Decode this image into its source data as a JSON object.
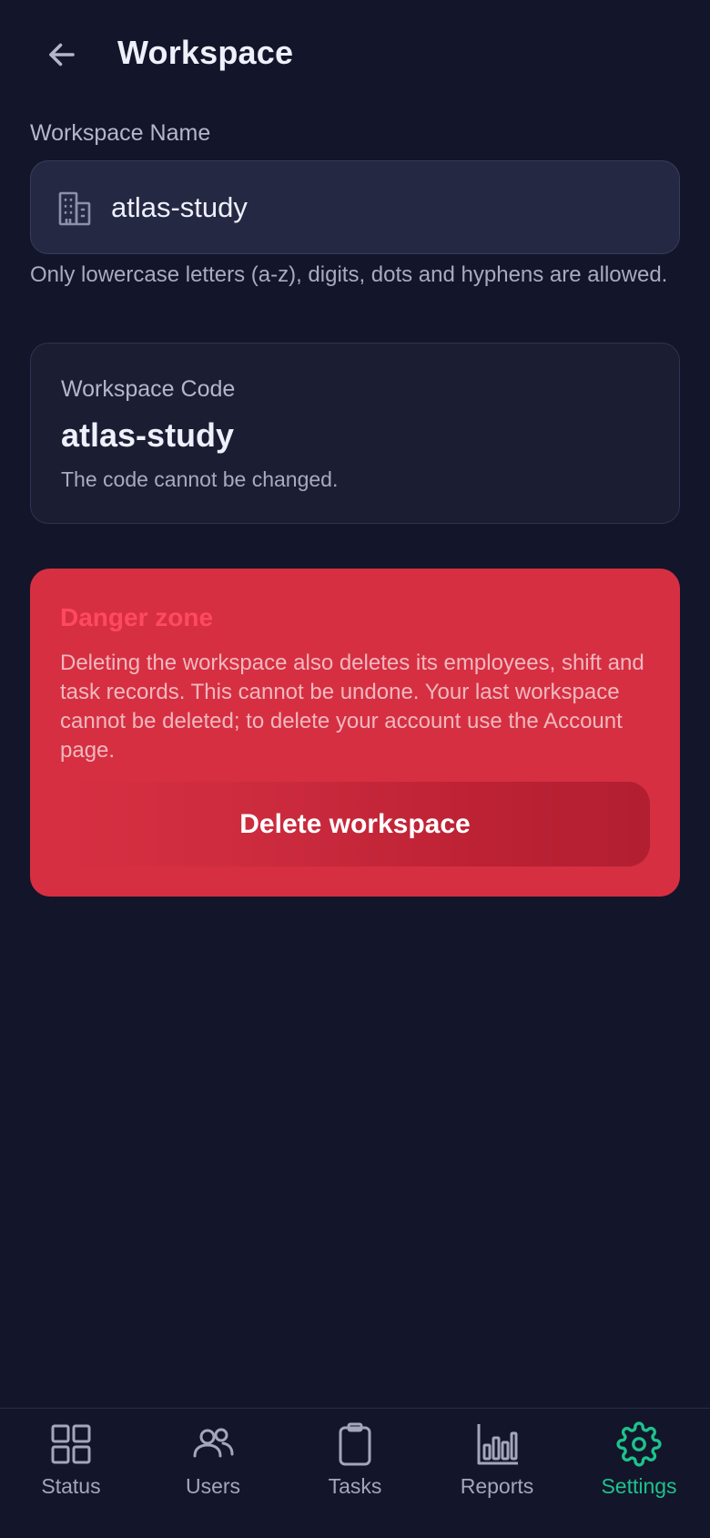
{
  "header": {
    "title": "Workspace",
    "back_icon": "arrow-left-icon"
  },
  "workspace_name": {
    "label": "Workspace Name",
    "value": "atlas-study",
    "icon": "building-icon",
    "helper": "Only lowercase letters (a-z), digits, dots and hyphens are allowed."
  },
  "workspace_code": {
    "label": "Workspace Code",
    "value": "atlas-study",
    "note": "The code cannot be changed."
  },
  "danger_zone": {
    "title": "Danger zone",
    "description": "Deleting the workspace also deletes its employees, shift and task records. This cannot be undone. Your last workspace cannot be deleted; to delete your account use the Account page.",
    "button_label": "Delete workspace"
  },
  "bottom_nav": {
    "items": [
      {
        "label": "Status",
        "icon": "grid-icon",
        "active": false
      },
      {
        "label": "Users",
        "icon": "users-icon",
        "active": false
      },
      {
        "label": "Tasks",
        "icon": "clipboard-icon",
        "active": false
      },
      {
        "label": "Reports",
        "icon": "bar-chart-icon",
        "active": false
      },
      {
        "label": "Settings",
        "icon": "gear-icon",
        "active": true
      }
    ]
  },
  "colors": {
    "background": "#13152a",
    "input_bg": "#252842",
    "card_bg": "#1b1d33",
    "danger": "#d62f42",
    "danger_title": "#ff4a5e",
    "accent": "#1ec28b",
    "nav_inactive": "#a3a6bc"
  }
}
